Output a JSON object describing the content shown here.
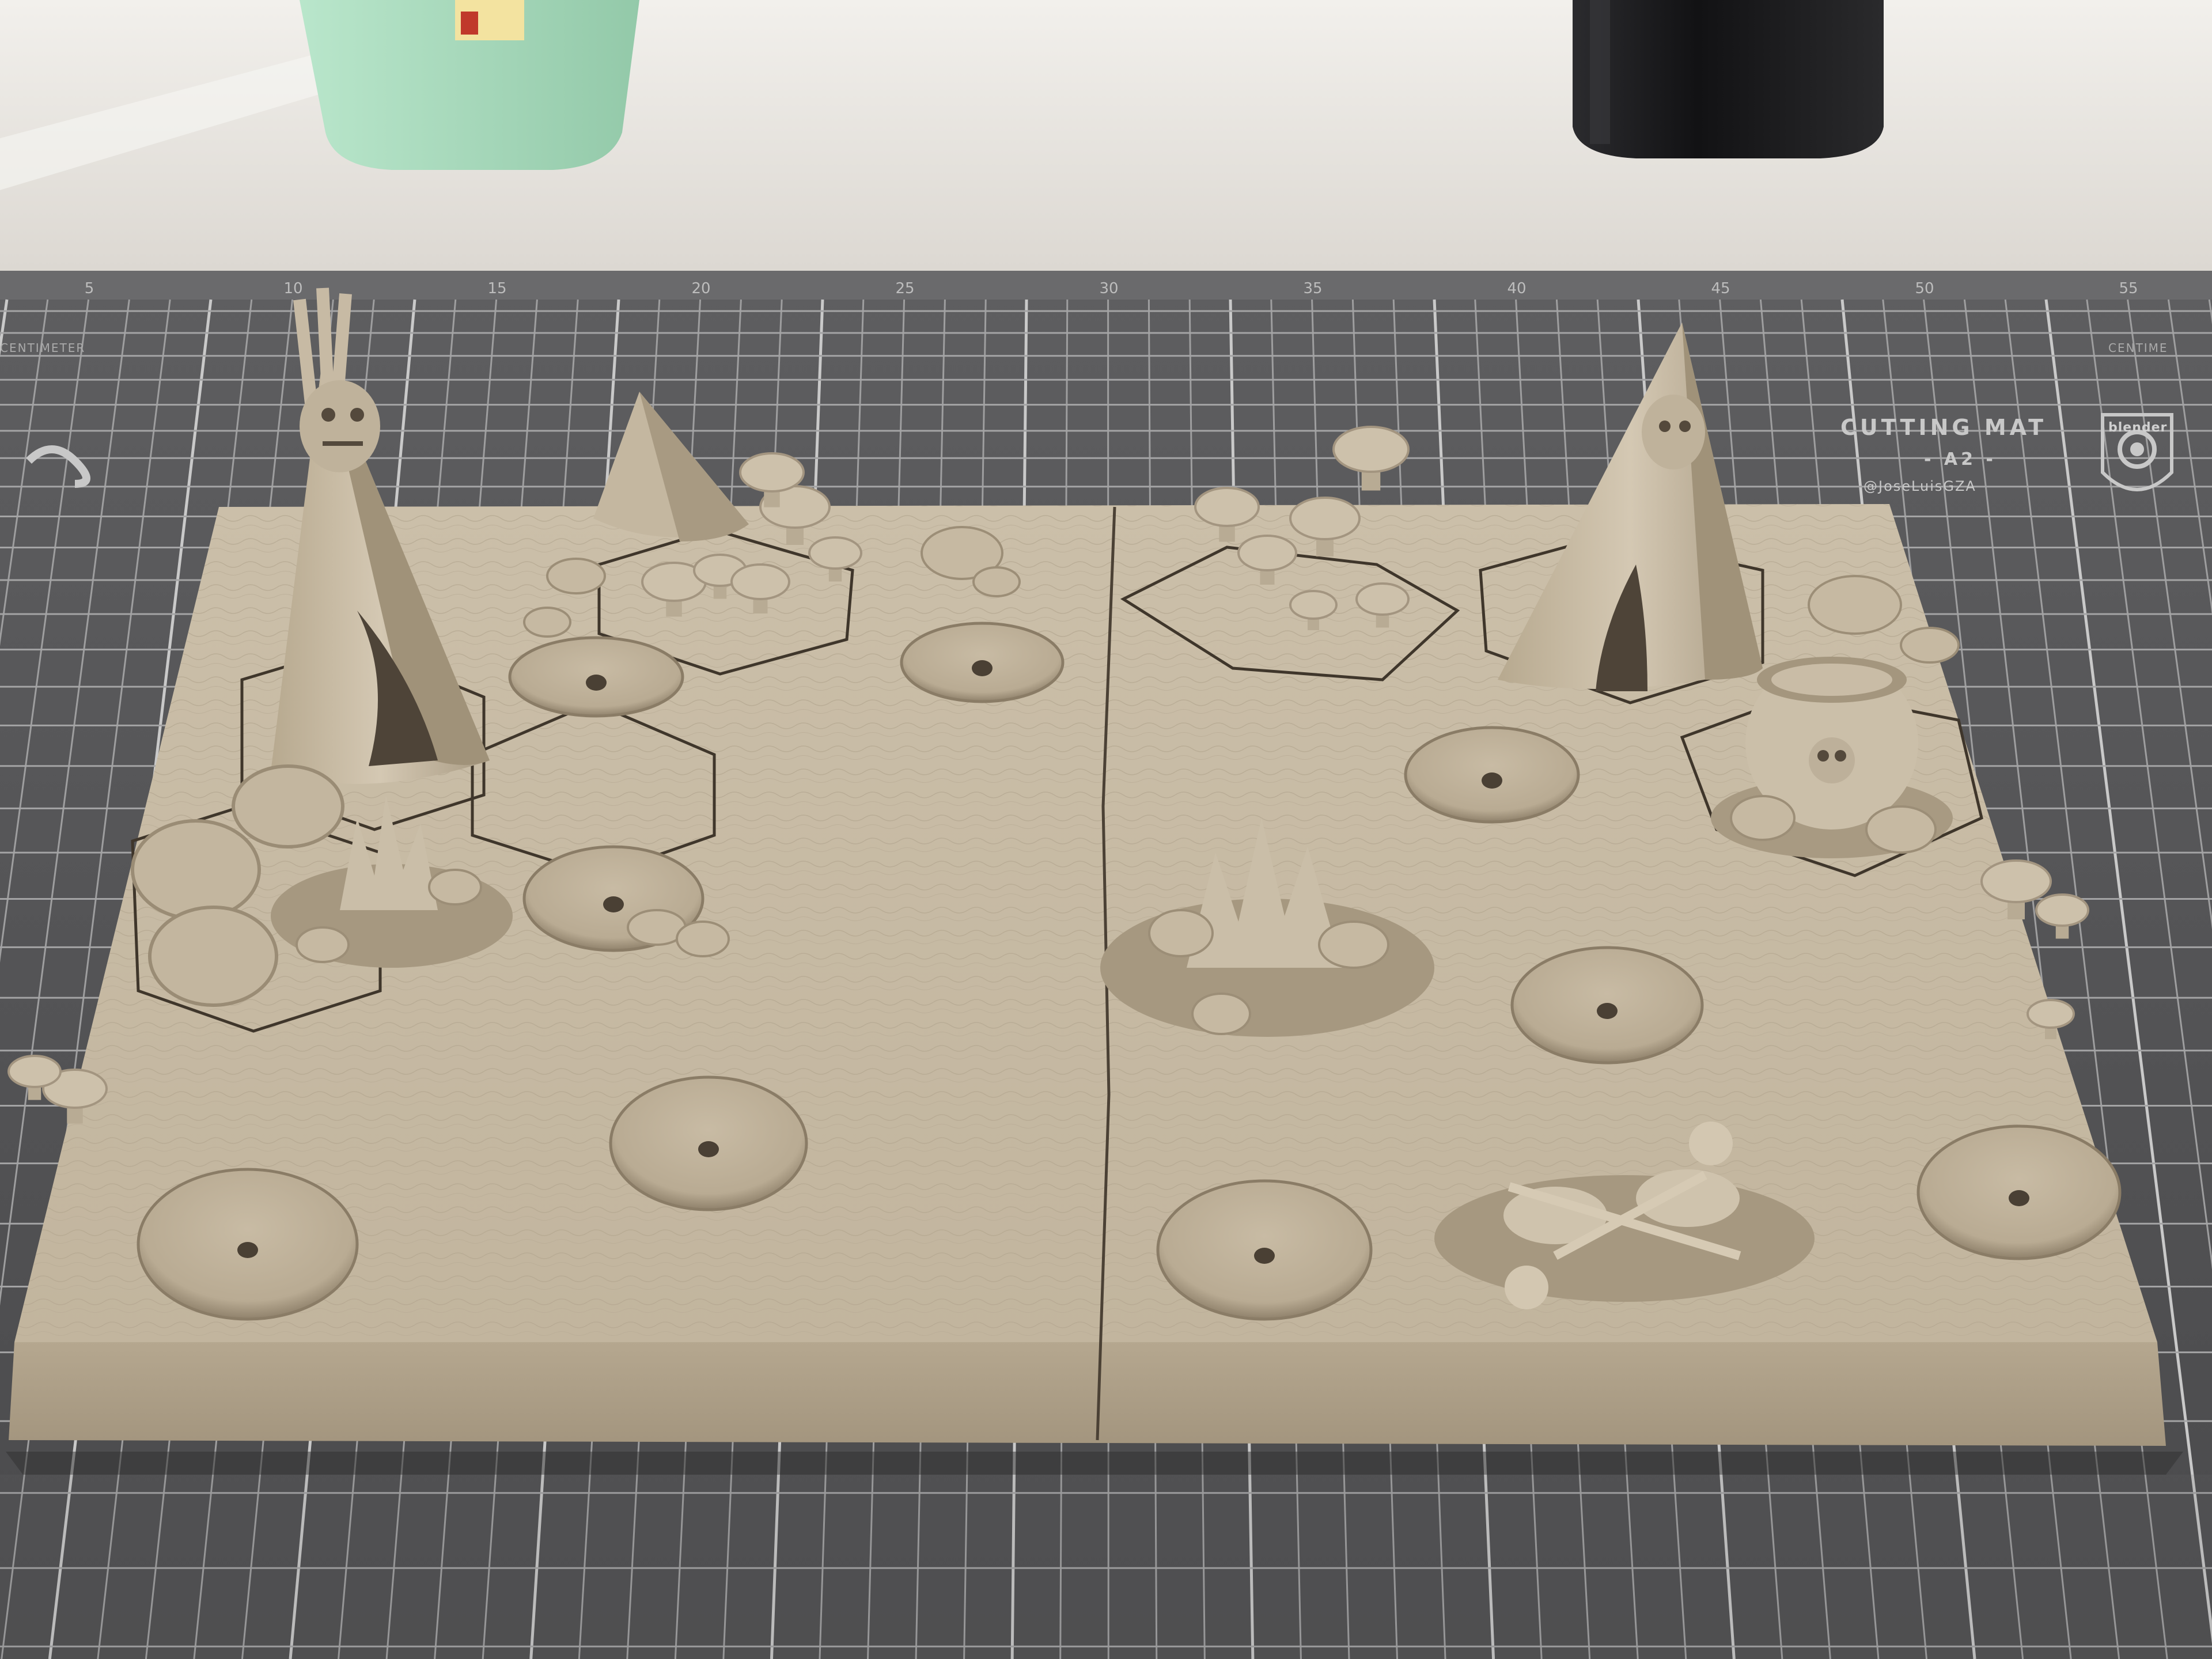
{
  "image": {
    "subject": "3D-printed tabletop terrain board with teepees, mushrooms, campfires, a cauldron, skeletons and round base holes, resting on a grey cutting mat",
    "palette": {
      "wall": "#e9e6e1",
      "mat": "#58585a",
      "mat_lines": "#b9b9b9",
      "terrain": "#c9bca6",
      "terrain_shadow": "#9f917b",
      "cup": "#a8d9bd",
      "jar": "#1b1b1d"
    }
  },
  "mat": {
    "title": "CUTTING MAT",
    "size": "- A2 -",
    "credit": "@JoseLuisGZA",
    "logo_text": "blender",
    "unit_label": "CENTIMETER",
    "unit_label_right": "CENTIME",
    "ruler_numbers": [
      "5",
      "10",
      "15",
      "20",
      "25",
      "30",
      "35",
      "40",
      "45",
      "50",
      "55"
    ]
  }
}
